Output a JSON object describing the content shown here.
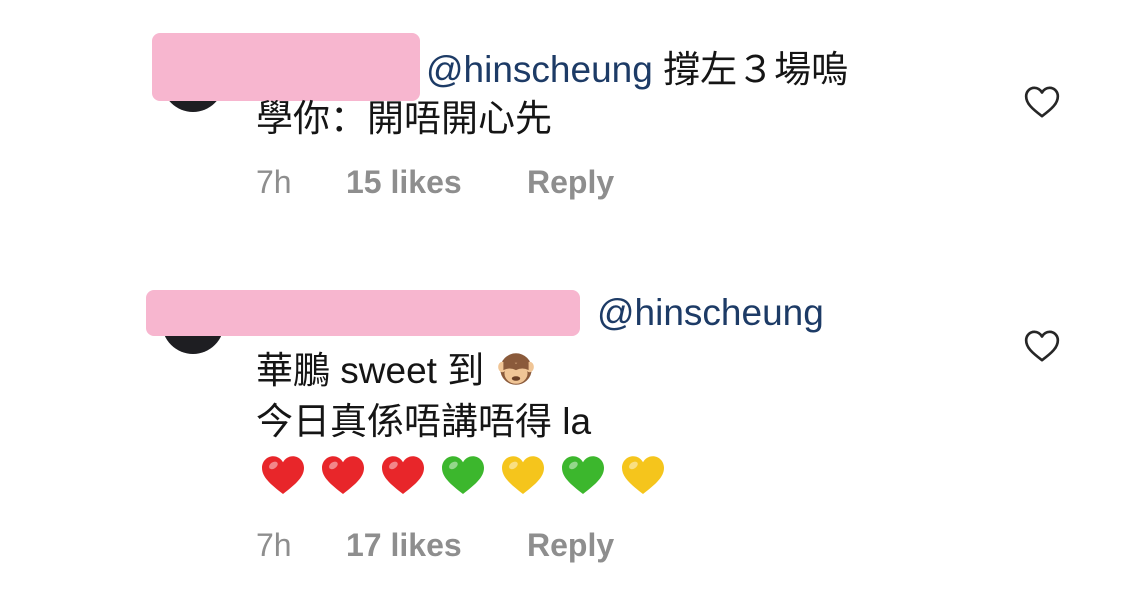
{
  "comments": [
    {
      "mention": "@hinscheung",
      "line1_rest": " 撐左３場嗚",
      "line2": "學你：開唔開心先",
      "time": "7h",
      "likes": "15 likes",
      "reply": "Reply"
    },
    {
      "mention": "@hinscheung",
      "line1_rest": "",
      "line2_text": "華鵬 sweet 到",
      "line2_emoji": "see-no-evil-monkey",
      "line3": "今日真係唔講唔得 la",
      "hearts": [
        "#e8262a",
        "#e8262a",
        "#e8262a",
        "#3cb72d",
        "#f5c51c",
        "#3cb72d",
        "#f5c51c"
      ],
      "time": "7h",
      "likes": "17 likes",
      "reply": "Reply"
    }
  ],
  "icons": {
    "like": "heart-outline-icon"
  }
}
